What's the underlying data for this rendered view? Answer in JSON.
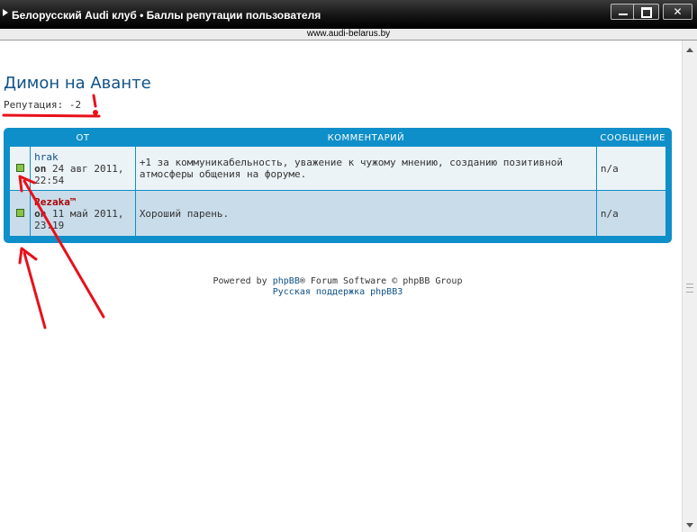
{
  "window": {
    "title": "Белорусский Audi клуб • Баллы репутации пользователя",
    "url": "www.audi-belarus.by"
  },
  "page": {
    "title": "Димон на Аванте",
    "reputation": "Репутация: -2"
  },
  "table": {
    "headers": {
      "from": "ОТ",
      "comment": "КОММЕНТАРИЙ",
      "message": "СООБЩЕНИЕ"
    },
    "rows": [
      {
        "user": "hrak",
        "on": "on",
        "date": "24 авг 2011, 22:54",
        "comment": "+1 за коммуникабельность, уважение к чужому мнению, созданию позитивной атмосферы общения на форуме.",
        "message": "n/a",
        "user_color": "#105289"
      },
      {
        "user": "Rezaka™",
        "on": "on",
        "date": "11 май 2011, 23:19",
        "comment": "Хороший парень.",
        "message": "n/a",
        "user_color": "#aa0000"
      }
    ]
  },
  "footer": {
    "powered_prefix": "Powered by",
    "phpbb_link": "phpBB",
    "powered_suffix": "® Forum Software © phpBB Group",
    "support_link": "Русская поддержка phpBB3"
  },
  "colors": {
    "panel": "#0f8fc9",
    "title": "#105289",
    "annotation": "#e8101a"
  }
}
